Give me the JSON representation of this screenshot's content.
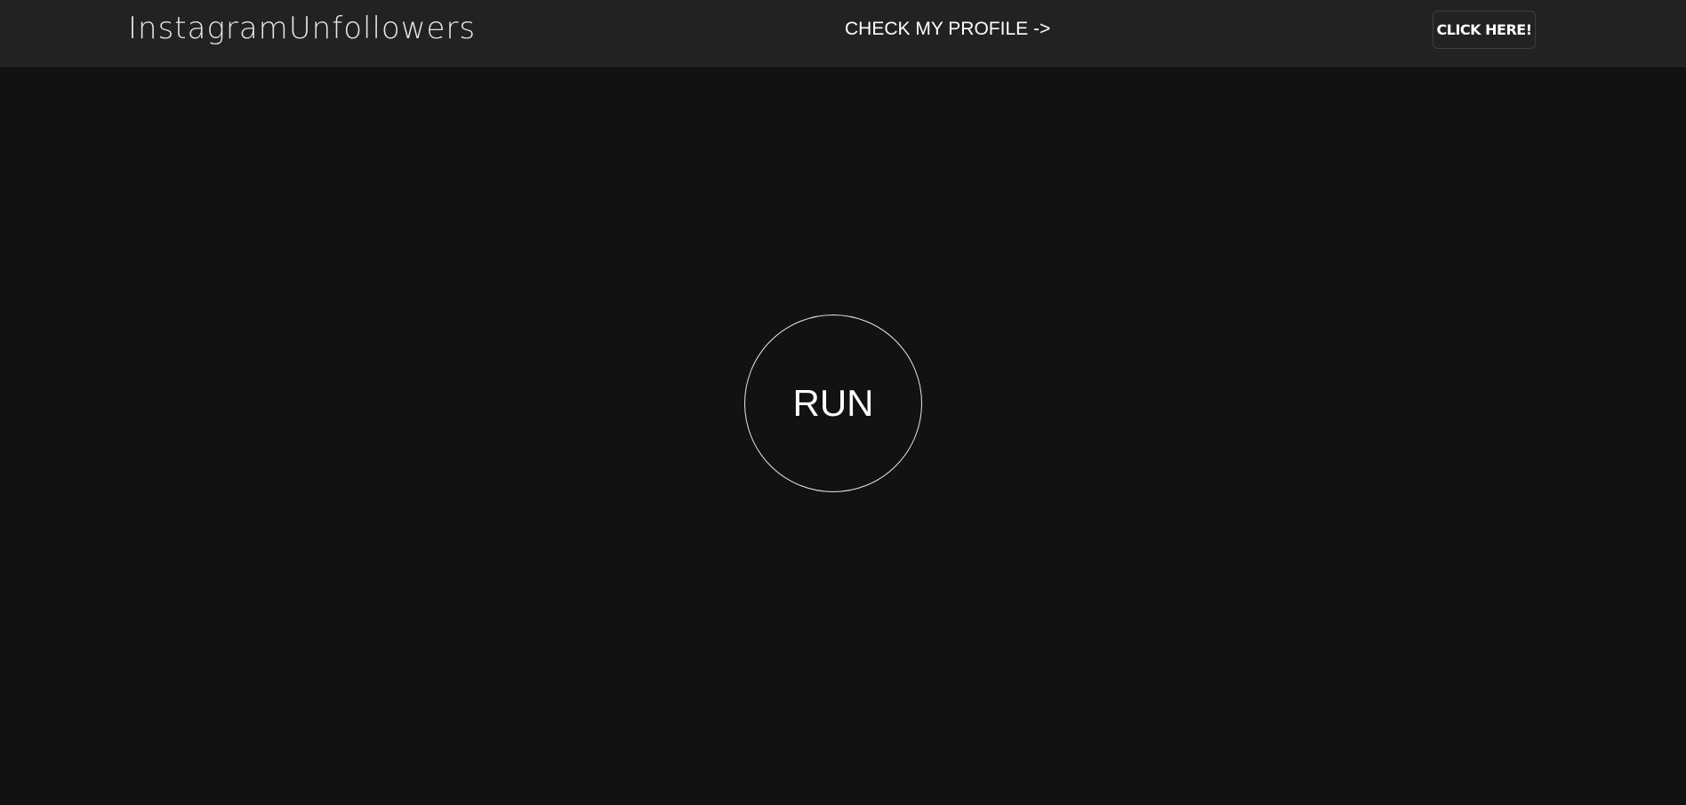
{
  "header": {
    "brand": "InstagramUnfollowers",
    "profile_link": "CHECK MY PROFILE ->",
    "cta_button": "CLICK HERE!"
  },
  "main": {
    "run_button": "RUN"
  },
  "colors": {
    "background": "#121212",
    "header_background": "#222222",
    "text": "#ffffff"
  }
}
